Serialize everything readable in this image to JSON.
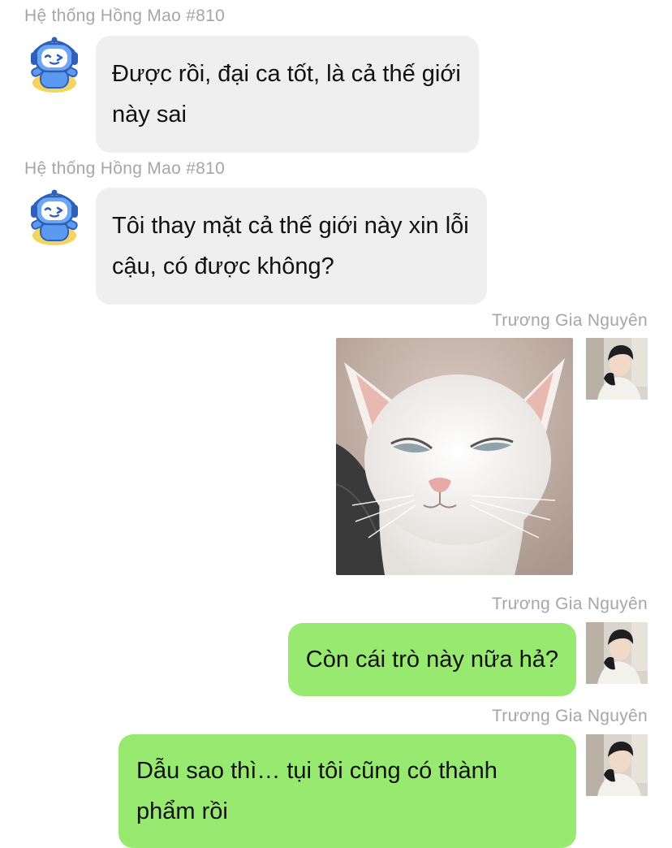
{
  "messages": [
    {
      "sender": "Hệ thống Hồng Mao #810",
      "lines": [
        "Được rồi, đại ca tốt, là cả thế giới",
        "này sai"
      ]
    },
    {
      "sender": "Hệ thống Hồng Mao #810",
      "lines": [
        "Tôi thay mặt cả thế giới này xin lỗi",
        "cậu, có được không?"
      ]
    },
    {
      "sender": "Trương Gia Nguyên",
      "image": "white-cat-meme"
    },
    {
      "sender": "Trương Gia Nguyên",
      "lines": [
        "Còn cái trò này nữa hả?"
      ]
    },
    {
      "sender": "Trương Gia Nguyên",
      "lines": [
        "Dẫu sao thì… tụi tôi cũng có thành",
        "phẩm rồi"
      ]
    }
  ],
  "colors": {
    "incoming_bubble": "#efefef",
    "outgoing_bubble": "#97e970",
    "sender_name": "#a6a6a6",
    "bot_avatar": "#3d7be0"
  }
}
